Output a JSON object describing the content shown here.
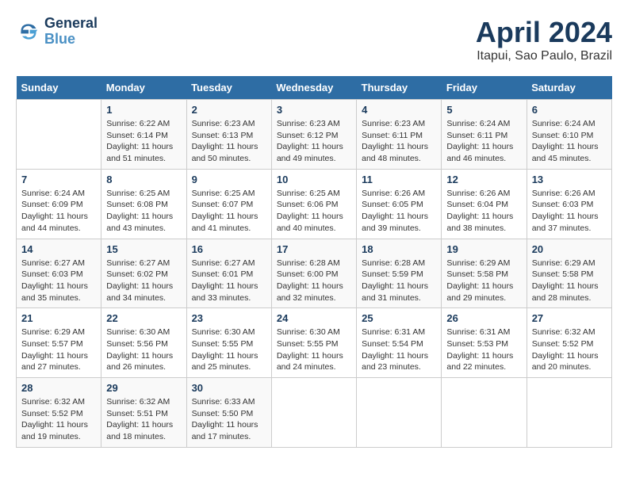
{
  "logo": {
    "line1": "General",
    "line2": "Blue"
  },
  "title": "April 2024",
  "subtitle": "Itapui, Sao Paulo, Brazil",
  "days_of_week": [
    "Sunday",
    "Monday",
    "Tuesday",
    "Wednesday",
    "Thursday",
    "Friday",
    "Saturday"
  ],
  "weeks": [
    [
      {
        "day": "",
        "sunrise": "",
        "sunset": "",
        "daylight": ""
      },
      {
        "day": "1",
        "sunrise": "Sunrise: 6:22 AM",
        "sunset": "Sunset: 6:14 PM",
        "daylight": "Daylight: 11 hours and 51 minutes."
      },
      {
        "day": "2",
        "sunrise": "Sunrise: 6:23 AM",
        "sunset": "Sunset: 6:13 PM",
        "daylight": "Daylight: 11 hours and 50 minutes."
      },
      {
        "day": "3",
        "sunrise": "Sunrise: 6:23 AM",
        "sunset": "Sunset: 6:12 PM",
        "daylight": "Daylight: 11 hours and 49 minutes."
      },
      {
        "day": "4",
        "sunrise": "Sunrise: 6:23 AM",
        "sunset": "Sunset: 6:11 PM",
        "daylight": "Daylight: 11 hours and 48 minutes."
      },
      {
        "day": "5",
        "sunrise": "Sunrise: 6:24 AM",
        "sunset": "Sunset: 6:11 PM",
        "daylight": "Daylight: 11 hours and 46 minutes."
      },
      {
        "day": "6",
        "sunrise": "Sunrise: 6:24 AM",
        "sunset": "Sunset: 6:10 PM",
        "daylight": "Daylight: 11 hours and 45 minutes."
      }
    ],
    [
      {
        "day": "7",
        "sunrise": "Sunrise: 6:24 AM",
        "sunset": "Sunset: 6:09 PM",
        "daylight": "Daylight: 11 hours and 44 minutes."
      },
      {
        "day": "8",
        "sunrise": "Sunrise: 6:25 AM",
        "sunset": "Sunset: 6:08 PM",
        "daylight": "Daylight: 11 hours and 43 minutes."
      },
      {
        "day": "9",
        "sunrise": "Sunrise: 6:25 AM",
        "sunset": "Sunset: 6:07 PM",
        "daylight": "Daylight: 11 hours and 41 minutes."
      },
      {
        "day": "10",
        "sunrise": "Sunrise: 6:25 AM",
        "sunset": "Sunset: 6:06 PM",
        "daylight": "Daylight: 11 hours and 40 minutes."
      },
      {
        "day": "11",
        "sunrise": "Sunrise: 6:26 AM",
        "sunset": "Sunset: 6:05 PM",
        "daylight": "Daylight: 11 hours and 39 minutes."
      },
      {
        "day": "12",
        "sunrise": "Sunrise: 6:26 AM",
        "sunset": "Sunset: 6:04 PM",
        "daylight": "Daylight: 11 hours and 38 minutes."
      },
      {
        "day": "13",
        "sunrise": "Sunrise: 6:26 AM",
        "sunset": "Sunset: 6:03 PM",
        "daylight": "Daylight: 11 hours and 37 minutes."
      }
    ],
    [
      {
        "day": "14",
        "sunrise": "Sunrise: 6:27 AM",
        "sunset": "Sunset: 6:03 PM",
        "daylight": "Daylight: 11 hours and 35 minutes."
      },
      {
        "day": "15",
        "sunrise": "Sunrise: 6:27 AM",
        "sunset": "Sunset: 6:02 PM",
        "daylight": "Daylight: 11 hours and 34 minutes."
      },
      {
        "day": "16",
        "sunrise": "Sunrise: 6:27 AM",
        "sunset": "Sunset: 6:01 PM",
        "daylight": "Daylight: 11 hours and 33 minutes."
      },
      {
        "day": "17",
        "sunrise": "Sunrise: 6:28 AM",
        "sunset": "Sunset: 6:00 PM",
        "daylight": "Daylight: 11 hours and 32 minutes."
      },
      {
        "day": "18",
        "sunrise": "Sunrise: 6:28 AM",
        "sunset": "Sunset: 5:59 PM",
        "daylight": "Daylight: 11 hours and 31 minutes."
      },
      {
        "day": "19",
        "sunrise": "Sunrise: 6:29 AM",
        "sunset": "Sunset: 5:58 PM",
        "daylight": "Daylight: 11 hours and 29 minutes."
      },
      {
        "day": "20",
        "sunrise": "Sunrise: 6:29 AM",
        "sunset": "Sunset: 5:58 PM",
        "daylight": "Daylight: 11 hours and 28 minutes."
      }
    ],
    [
      {
        "day": "21",
        "sunrise": "Sunrise: 6:29 AM",
        "sunset": "Sunset: 5:57 PM",
        "daylight": "Daylight: 11 hours and 27 minutes."
      },
      {
        "day": "22",
        "sunrise": "Sunrise: 6:30 AM",
        "sunset": "Sunset: 5:56 PM",
        "daylight": "Daylight: 11 hours and 26 minutes."
      },
      {
        "day": "23",
        "sunrise": "Sunrise: 6:30 AM",
        "sunset": "Sunset: 5:55 PM",
        "daylight": "Daylight: 11 hours and 25 minutes."
      },
      {
        "day": "24",
        "sunrise": "Sunrise: 6:30 AM",
        "sunset": "Sunset: 5:55 PM",
        "daylight": "Daylight: 11 hours and 24 minutes."
      },
      {
        "day": "25",
        "sunrise": "Sunrise: 6:31 AM",
        "sunset": "Sunset: 5:54 PM",
        "daylight": "Daylight: 11 hours and 23 minutes."
      },
      {
        "day": "26",
        "sunrise": "Sunrise: 6:31 AM",
        "sunset": "Sunset: 5:53 PM",
        "daylight": "Daylight: 11 hours and 22 minutes."
      },
      {
        "day": "27",
        "sunrise": "Sunrise: 6:32 AM",
        "sunset": "Sunset: 5:52 PM",
        "daylight": "Daylight: 11 hours and 20 minutes."
      }
    ],
    [
      {
        "day": "28",
        "sunrise": "Sunrise: 6:32 AM",
        "sunset": "Sunset: 5:52 PM",
        "daylight": "Daylight: 11 hours and 19 minutes."
      },
      {
        "day": "29",
        "sunrise": "Sunrise: 6:32 AM",
        "sunset": "Sunset: 5:51 PM",
        "daylight": "Daylight: 11 hours and 18 minutes."
      },
      {
        "day": "30",
        "sunrise": "Sunrise: 6:33 AM",
        "sunset": "Sunset: 5:50 PM",
        "daylight": "Daylight: 11 hours and 17 minutes."
      },
      {
        "day": "",
        "sunrise": "",
        "sunset": "",
        "daylight": ""
      },
      {
        "day": "",
        "sunrise": "",
        "sunset": "",
        "daylight": ""
      },
      {
        "day": "",
        "sunrise": "",
        "sunset": "",
        "daylight": ""
      },
      {
        "day": "",
        "sunrise": "",
        "sunset": "",
        "daylight": ""
      }
    ]
  ]
}
